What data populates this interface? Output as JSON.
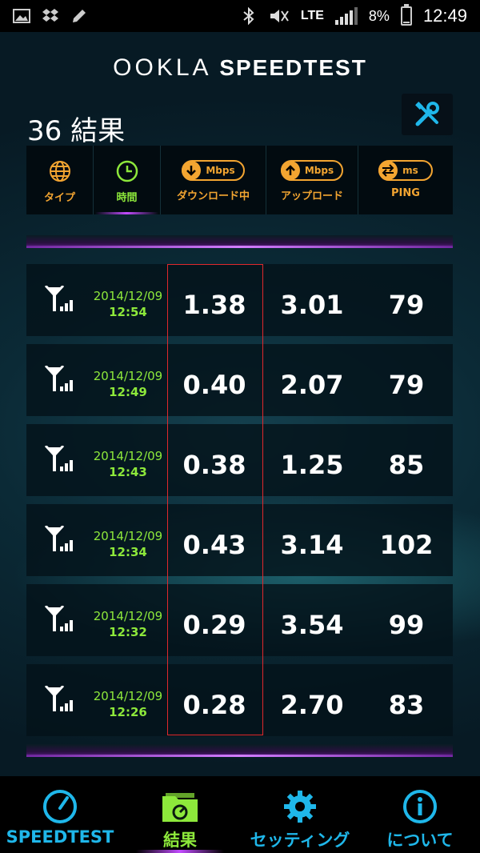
{
  "status_bar": {
    "network": "LTE",
    "battery": "8%",
    "battery_level": 0.08,
    "time": "12:49"
  },
  "header": {
    "logo_left": "OOKLA",
    "logo_right": "SPEEDTEST",
    "results_title": "36 結果"
  },
  "sort_tabs": [
    {
      "label": "タイプ",
      "icon": "globe-icon",
      "active": false
    },
    {
      "label": "時間",
      "icon": "clock-icon",
      "active": true
    },
    {
      "label": "ダウンロード中",
      "unit": "Mbps",
      "icon": "download-arrow-icon",
      "active": false
    },
    {
      "label": "アップロード",
      "unit": "Mbps",
      "icon": "upload-arrow-icon",
      "active": false
    },
    {
      "label": "PING",
      "unit": "ms",
      "icon": "ping-arrows-icon",
      "active": false
    }
  ],
  "results": [
    {
      "date": "2014/12/09",
      "time": "12:54",
      "download": "1.38",
      "upload": "3.01",
      "ping": "79"
    },
    {
      "date": "2014/12/09",
      "time": "12:49",
      "download": "0.40",
      "upload": "2.07",
      "ping": "79"
    },
    {
      "date": "2014/12/09",
      "time": "12:43",
      "download": "0.38",
      "upload": "1.25",
      "ping": "85"
    },
    {
      "date": "2014/12/09",
      "time": "12:34",
      "download": "0.43",
      "upload": "3.14",
      "ping": "102"
    },
    {
      "date": "2014/12/09",
      "time": "12:32",
      "download": "0.29",
      "upload": "3.54",
      "ping": "99"
    },
    {
      "date": "2014/12/09",
      "time": "12:26",
      "download": "0.28",
      "upload": "2.70",
      "ping": "83"
    }
  ],
  "bottom_nav": [
    {
      "label": "SPEEDTEST",
      "icon": "speedometer-icon",
      "active": false
    },
    {
      "label": "結果",
      "icon": "results-folder-icon",
      "active": true
    },
    {
      "label": "セッティング",
      "icon": "gear-icon",
      "active": false
    },
    {
      "label": "について",
      "icon": "info-icon",
      "active": false
    }
  ],
  "colors": {
    "accent_orange": "#f3a531",
    "accent_green": "#8de83b",
    "accent_blue": "#1fb7ea",
    "accent_purple": "#c24bff",
    "highlight_red": "#e0282c"
  }
}
